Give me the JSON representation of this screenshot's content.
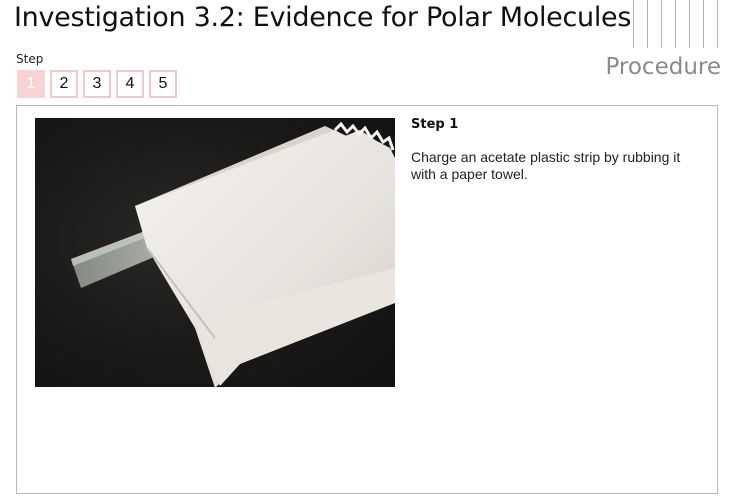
{
  "header": {
    "title": "Investigation 3.2: Evidence for Polar Molecules",
    "section_label": "Procedure"
  },
  "step_nav": {
    "caption": "Step",
    "steps": [
      "1",
      "2",
      "3",
      "4",
      "5"
    ],
    "active_step": "1"
  },
  "content": {
    "step_heading": "Step 1",
    "instruction": "Charge an acetate plastic strip by rubbing it with a paper towel.",
    "image_subject": "paper towel wrapped around acetate plastic strip on dark background"
  },
  "colors": {
    "active_step_bg": "#f9d3d3",
    "step_border": "#f2c9c9",
    "procedure_text": "#8a8a8a"
  }
}
